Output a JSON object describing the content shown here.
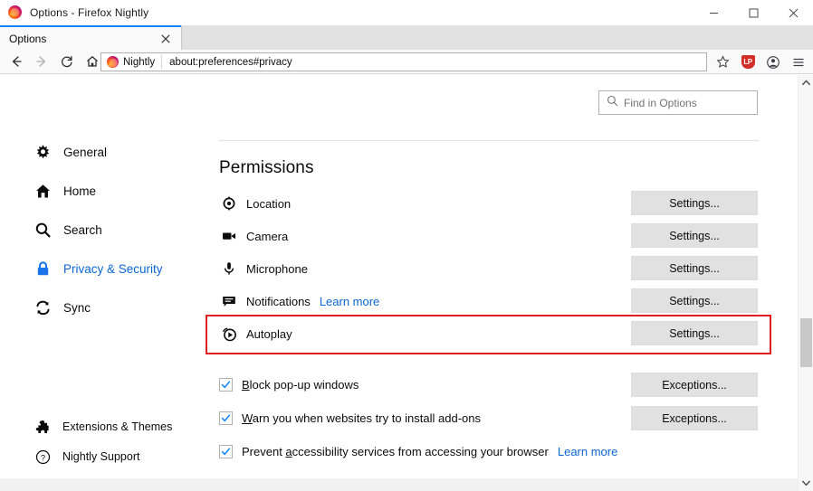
{
  "window": {
    "title": "Options - Firefox Nightly",
    "app_icon": "firefox-logo-icon",
    "minimize": "minimize-icon",
    "maximize": "maximize-icon",
    "close": "close-icon"
  },
  "tabs": [
    {
      "label": "Options",
      "close_label": "×",
      "active": true
    }
  ],
  "navbar": {
    "back": "back-arrow-icon",
    "forward": "forward-arrow-icon",
    "reload": "reload-icon",
    "home": "home-icon",
    "identity_brand": "Nightly",
    "url": "about:preferences#privacy",
    "bookmark": "star-icon",
    "extension": "LP",
    "account": "account-icon",
    "menu": "hamburger-menu-icon"
  },
  "search": {
    "placeholder": "Find in Options",
    "value": "",
    "icon": "search-icon"
  },
  "sidebar": {
    "items": [
      {
        "label": "General",
        "icon": "gear-icon",
        "selected": false
      },
      {
        "label": "Home",
        "icon": "home-icon",
        "selected": false
      },
      {
        "label": "Search",
        "icon": "search-icon",
        "selected": false
      },
      {
        "label": "Privacy & Security",
        "icon": "lock-icon",
        "selected": true
      },
      {
        "label": "Sync",
        "icon": "sync-icon",
        "selected": false
      }
    ],
    "footer_items": [
      {
        "label": "Extensions & Themes",
        "icon": "puzzle-piece-icon"
      },
      {
        "label": "Nightly Support",
        "icon": "question-circle-icon"
      }
    ]
  },
  "main": {
    "section_title": "Permissions",
    "permissions": [
      {
        "label": "Location",
        "icon": "location-icon",
        "button": "Settings...",
        "accesskey": "t",
        "learn_more": null
      },
      {
        "label": "Camera",
        "icon": "camera-icon",
        "button": "Settings...",
        "accesskey": "t",
        "learn_more": null
      },
      {
        "label": "Microphone",
        "icon": "microphone-icon",
        "button": "Settings...",
        "accesskey": "t",
        "learn_more": null
      },
      {
        "label": "Notifications",
        "icon": "notification-icon",
        "button": "Settings...",
        "accesskey": "t",
        "learn_more": "Learn more"
      },
      {
        "label": "Autoplay",
        "icon": "autoplay-icon",
        "button": "Settings...",
        "accesskey": "t",
        "learn_more": null
      }
    ],
    "checkboxes": [
      {
        "label_pre": "",
        "accesskey": "B",
        "label_post": "lock pop-up windows",
        "checked": true,
        "button": "Exceptions...",
        "button_accesskey": "E",
        "learn_more": null
      },
      {
        "label_pre": "",
        "accesskey": "W",
        "label_post": "arn you when websites try to install add-ons",
        "checked": true,
        "button": "Exceptions...",
        "button_accesskey": "E",
        "learn_more": null
      },
      {
        "label_pre": "Prevent ",
        "accesskey": "a",
        "label_post": "ccessibility services from accessing your browser",
        "checked": true,
        "button": null,
        "button_accesskey": null,
        "learn_more": "Learn more"
      }
    ]
  },
  "highlight": {
    "target": "Autoplay",
    "color": "#e02020"
  },
  "colors": {
    "accent_blue": "#0a66d0",
    "tab_active_border": "#0a84ff",
    "checkbox_check": "#0a84ff",
    "button_face": "#e1e1e1",
    "highlight_red": "#e02020"
  },
  "scrollbar": {
    "up": "scroll-up-arrow-icon",
    "down": "scroll-down-arrow-icon"
  }
}
